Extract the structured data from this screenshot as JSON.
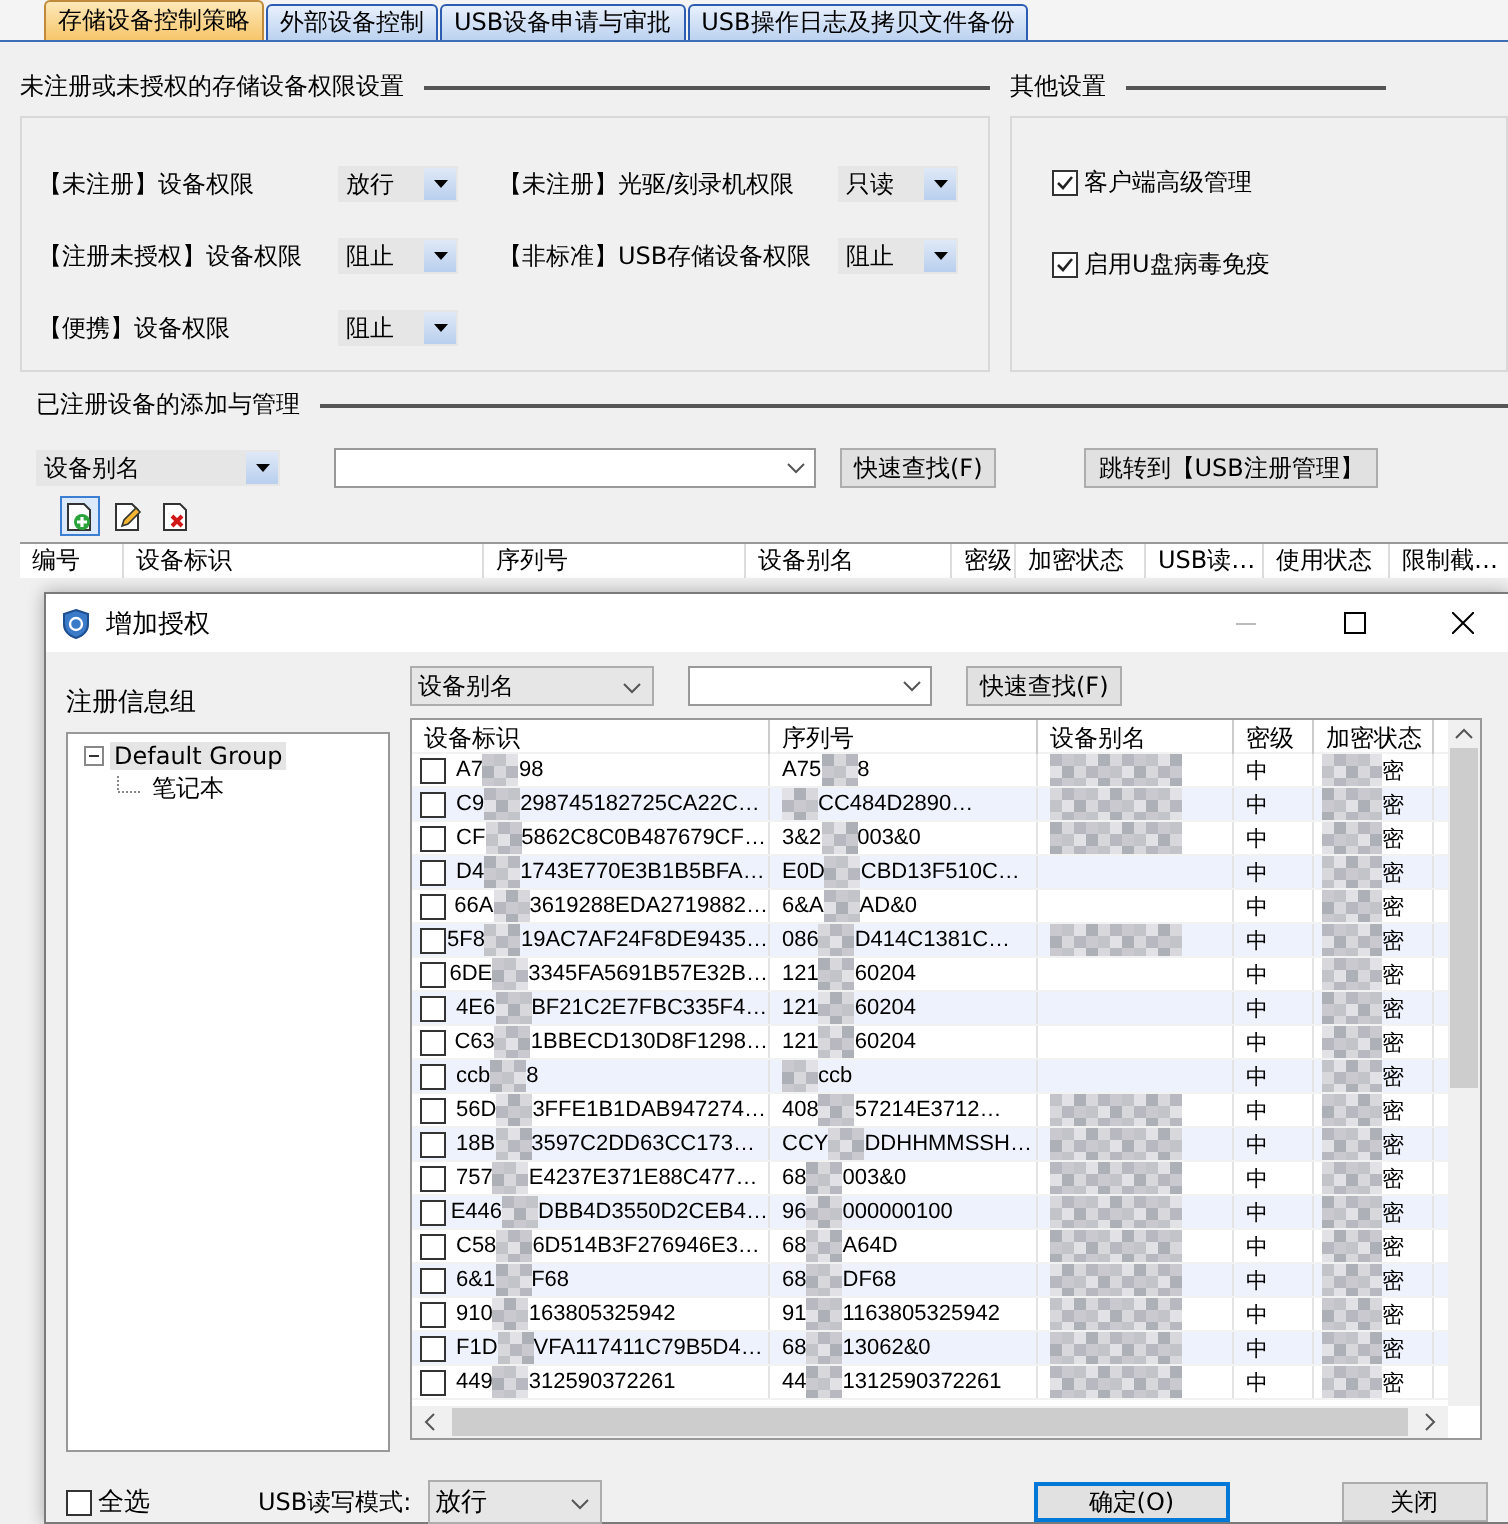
{
  "tabs": [
    {
      "label": "存储设备控制策略",
      "selected": true
    },
    {
      "label": "外部设备控制",
      "selected": false
    },
    {
      "label": "USB设备申请与审批",
      "selected": false
    },
    {
      "label": "USB操作日志及拷贝文件备份",
      "selected": false
    }
  ],
  "permission_section": {
    "title": "未注册或未授权的存储设备权限设置",
    "settings": [
      {
        "label": "【未注册】设备权限",
        "value": "放行"
      },
      {
        "label": "【未注册】光驱/刻录机权限",
        "value": "只读"
      },
      {
        "label": "【注册未授权】设备权限",
        "value": "阻止"
      },
      {
        "label": "【非标准】USB存储设备权限",
        "value": "阻止"
      },
      {
        "label": "【便携】设备权限",
        "value": "阻止"
      }
    ]
  },
  "other_settings": {
    "title": "其他设置",
    "options": [
      {
        "label": "客户端高级管理",
        "checked": true
      },
      {
        "label": "启用U盘病毒免疫",
        "checked": true
      }
    ]
  },
  "registered_section": {
    "title": "已注册设备的添加与管理",
    "search_field": "设备别名",
    "search_button": "快速查找(F)",
    "jump_button": "跳转到【USB注册管理】",
    "columns": [
      "编号",
      "设备标识",
      "序列号",
      "设备别名",
      "密级",
      "加密状态",
      "USB读…",
      "使用状态",
      "限制截…"
    ]
  },
  "dialog": {
    "title": "增加授权",
    "group_label": "注册信息组",
    "tree": [
      {
        "label": "Default Group",
        "selected": true,
        "expanded": true,
        "children": [
          {
            "label": "笔记本",
            "selected": false
          }
        ]
      }
    ],
    "search_field": "设备别名",
    "search_button": "快速查找(F)",
    "columns": [
      "设备标识",
      "序列号",
      "设备别名",
      "密级",
      "加密状态"
    ],
    "rows": [
      {
        "checked": false,
        "device_id": [
          "A7",
          "98"
        ],
        "serial": [
          "A75",
          "8"
        ],
        "alias_blurred": true,
        "level": "中",
        "encryption": "密"
      },
      {
        "checked": false,
        "device_id": [
          "C9",
          "298745182725CA22C…"
        ],
        "serial": [
          "CC484D2890…"
        ],
        "alias_blurred": true,
        "level": "中",
        "encryption": "密"
      },
      {
        "checked": false,
        "device_id": [
          "CF",
          "5862C8C0B487679CF…"
        ],
        "serial": [
          "3&2",
          "003&0"
        ],
        "alias_blurred": true,
        "level": "中",
        "encryption": "密"
      },
      {
        "checked": false,
        "device_id": [
          "D4",
          "1743E770E3B1B5BFA…"
        ],
        "serial": [
          "E0D",
          "CBD13F510C…"
        ],
        "alias_blurred": false,
        "level": "中",
        "encryption": "密"
      },
      {
        "checked": false,
        "device_id": [
          "66A",
          "3619288EDA2719882…"
        ],
        "serial": [
          "6&A",
          "AD&0"
        ],
        "alias_blurred": false,
        "level": "中",
        "encryption": "密"
      },
      {
        "checked": false,
        "device_id": [
          "5F8",
          "19AC7AF24F8DE9435…"
        ],
        "serial": [
          "086",
          "D414C1381C…"
        ],
        "alias_blurred": true,
        "level": "中",
        "encryption": "密"
      },
      {
        "checked": false,
        "device_id": [
          "6DE",
          "3345FA5691B57E32B…"
        ],
        "serial": [
          "121",
          "60204"
        ],
        "alias_blurred": false,
        "level": "中",
        "encryption": "密"
      },
      {
        "checked": false,
        "device_id": [
          "4E6",
          "BF21C2E7FBC335F4…"
        ],
        "serial": [
          "121",
          "60204"
        ],
        "alias_blurred": false,
        "level": "中",
        "encryption": "密"
      },
      {
        "checked": false,
        "device_id": [
          "C63",
          "1BBECD130D8F1298…"
        ],
        "serial": [
          "121",
          "60204"
        ],
        "alias_blurred": false,
        "level": "中",
        "encryption": "密"
      },
      {
        "checked": false,
        "device_id": [
          "ccb",
          "8"
        ],
        "serial": [
          "ccb"
        ],
        "alias_blurred": false,
        "level": "中",
        "encryption": "密"
      },
      {
        "checked": false,
        "device_id": [
          "56D",
          "3FFE1B1DAB947274…"
        ],
        "serial": [
          "408",
          "57214E3712…"
        ],
        "alias_blurred": true,
        "level": "中",
        "encryption": "密"
      },
      {
        "checked": false,
        "device_id": [
          "18B",
          "3597C2DD63CC173…"
        ],
        "serial": [
          "CCY",
          "DDHHMMSSH…"
        ],
        "alias_blurred": true,
        "level": "中",
        "encryption": "密"
      },
      {
        "checked": false,
        "device_id": [
          "757",
          "E4237E371E88C477…"
        ],
        "serial": [
          "68",
          "003&0"
        ],
        "alias_blurred": true,
        "level": "中",
        "encryption": "密"
      },
      {
        "checked": false,
        "device_id": [
          "E446",
          "DBB4D3550D2CEB4…"
        ],
        "serial": [
          "96",
          "000000100"
        ],
        "alias_blurred": true,
        "level": "中",
        "encryption": "密"
      },
      {
        "checked": false,
        "device_id": [
          "C58",
          "6D514B3F276946E3…"
        ],
        "serial": [
          "68",
          "A64D"
        ],
        "alias_blurred": true,
        "level": "中",
        "encryption": "密"
      },
      {
        "checked": false,
        "device_id": [
          "6&1",
          "F68"
        ],
        "serial": [
          "68",
          "DF68"
        ],
        "alias_blurred": true,
        "level": "中",
        "encryption": "密"
      },
      {
        "checked": false,
        "device_id": [
          "910",
          "163805325942"
        ],
        "serial": [
          "91",
          "1163805325942"
        ],
        "alias_blurred": true,
        "level": "中",
        "encryption": "密"
      },
      {
        "checked": false,
        "device_id": [
          "F1D",
          "VFA117411C79B5D4…"
        ],
        "serial": [
          "68",
          "13062&0"
        ],
        "alias_blurred": true,
        "level": "中",
        "encryption": "密"
      },
      {
        "checked": false,
        "device_id": [
          "449",
          "312590372261"
        ],
        "serial": [
          "44",
          "1312590372261"
        ],
        "alias_blurred": true,
        "level": "中",
        "encryption": "密"
      }
    ],
    "select_all": {
      "label": "全选",
      "checked": false
    },
    "mode_label": "USB读写模式:",
    "mode_value": "放行",
    "ok_button": "确定(O)",
    "close_button": "关闭"
  }
}
